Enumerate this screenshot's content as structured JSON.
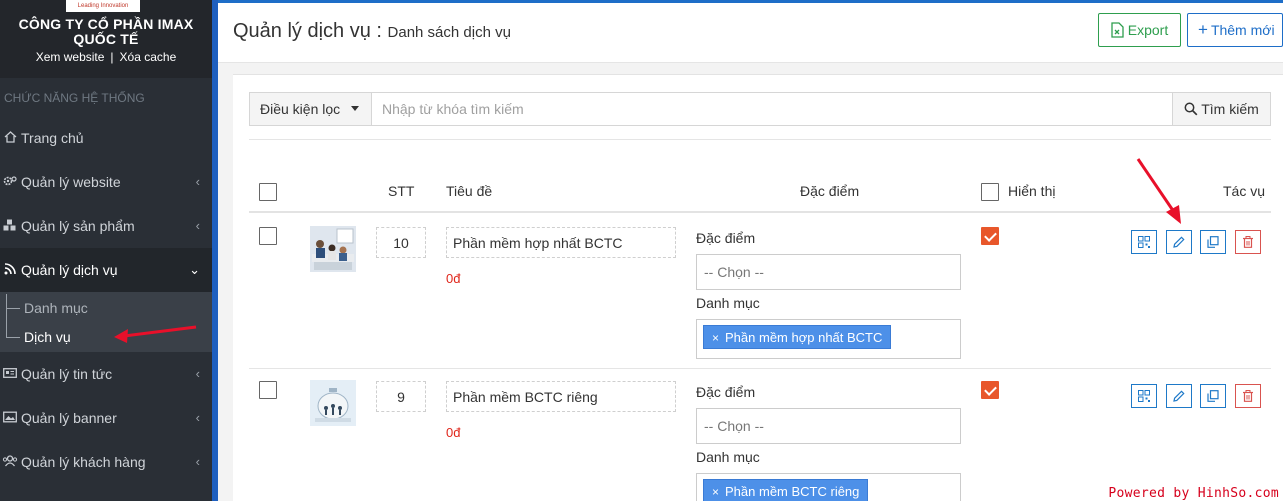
{
  "sidebar": {
    "logo_text": "Leading Innovation",
    "company": "CÔNG TY CỔ PHẦN IMAX QUỐC TẾ",
    "links": [
      "Xem website",
      "Xóa cache"
    ],
    "section_title": "CHỨC NĂNG HỆ THỐNG",
    "items": [
      {
        "label": "Trang chủ",
        "icon": "home-icon"
      },
      {
        "label": "Quản lý website",
        "icon": "gears-icon"
      },
      {
        "label": "Quản lý sản phẩm",
        "icon": "cubes-icon"
      },
      {
        "label": "Quản lý dịch vụ",
        "icon": "rss-icon"
      },
      {
        "label": "Quản lý tin tức",
        "icon": "newspaper-icon"
      },
      {
        "label": "Quản lý banner",
        "icon": "image-icon"
      },
      {
        "label": "Quản lý khách hàng",
        "icon": "users-icon"
      }
    ],
    "sub_items": [
      "Danh mục",
      "Dịch vụ"
    ]
  },
  "header": {
    "title": "Quản lý dịch vụ :",
    "subtitle": "Danh sách dịch vụ",
    "export_label": "Export",
    "add_label": "Thêm mới"
  },
  "filter": {
    "dropdown_label": "Điều kiện lọc",
    "search_placeholder": "Nhập từ khóa tìm kiếm",
    "search_button": "Tìm kiếm"
  },
  "table": {
    "columns": {
      "stt": "STT",
      "title": "Tiêu đề",
      "feature": "Đặc điểm",
      "visible": "Hiển thị",
      "actions": "Tác vụ"
    },
    "field_labels": {
      "feature": "Đặc điểm",
      "category": "Danh mục",
      "select_placeholder": "-- Chọn --"
    },
    "rows": [
      {
        "stt": "10",
        "title": "Phần mềm hợp nhất BCTC",
        "price": "0đ",
        "tag": "Phần mềm hợp nhất BCTC",
        "visible": true
      },
      {
        "stt": "9",
        "title": "Phần mềm BCTC riêng",
        "price": "0đ",
        "tag": "Phần mềm BCTC riêng",
        "visible": true
      }
    ]
  },
  "watermark": "Powered by HinhSo.com",
  "colors": {
    "sidebar_bg": "#2a2f36",
    "accent_blue": "#1e6ec8",
    "export_green": "#2e9e4e",
    "checked_orange": "#e8572b",
    "delete_red": "#d9534f",
    "price_red": "#e0261b",
    "annotation_red": "#e8102a"
  }
}
